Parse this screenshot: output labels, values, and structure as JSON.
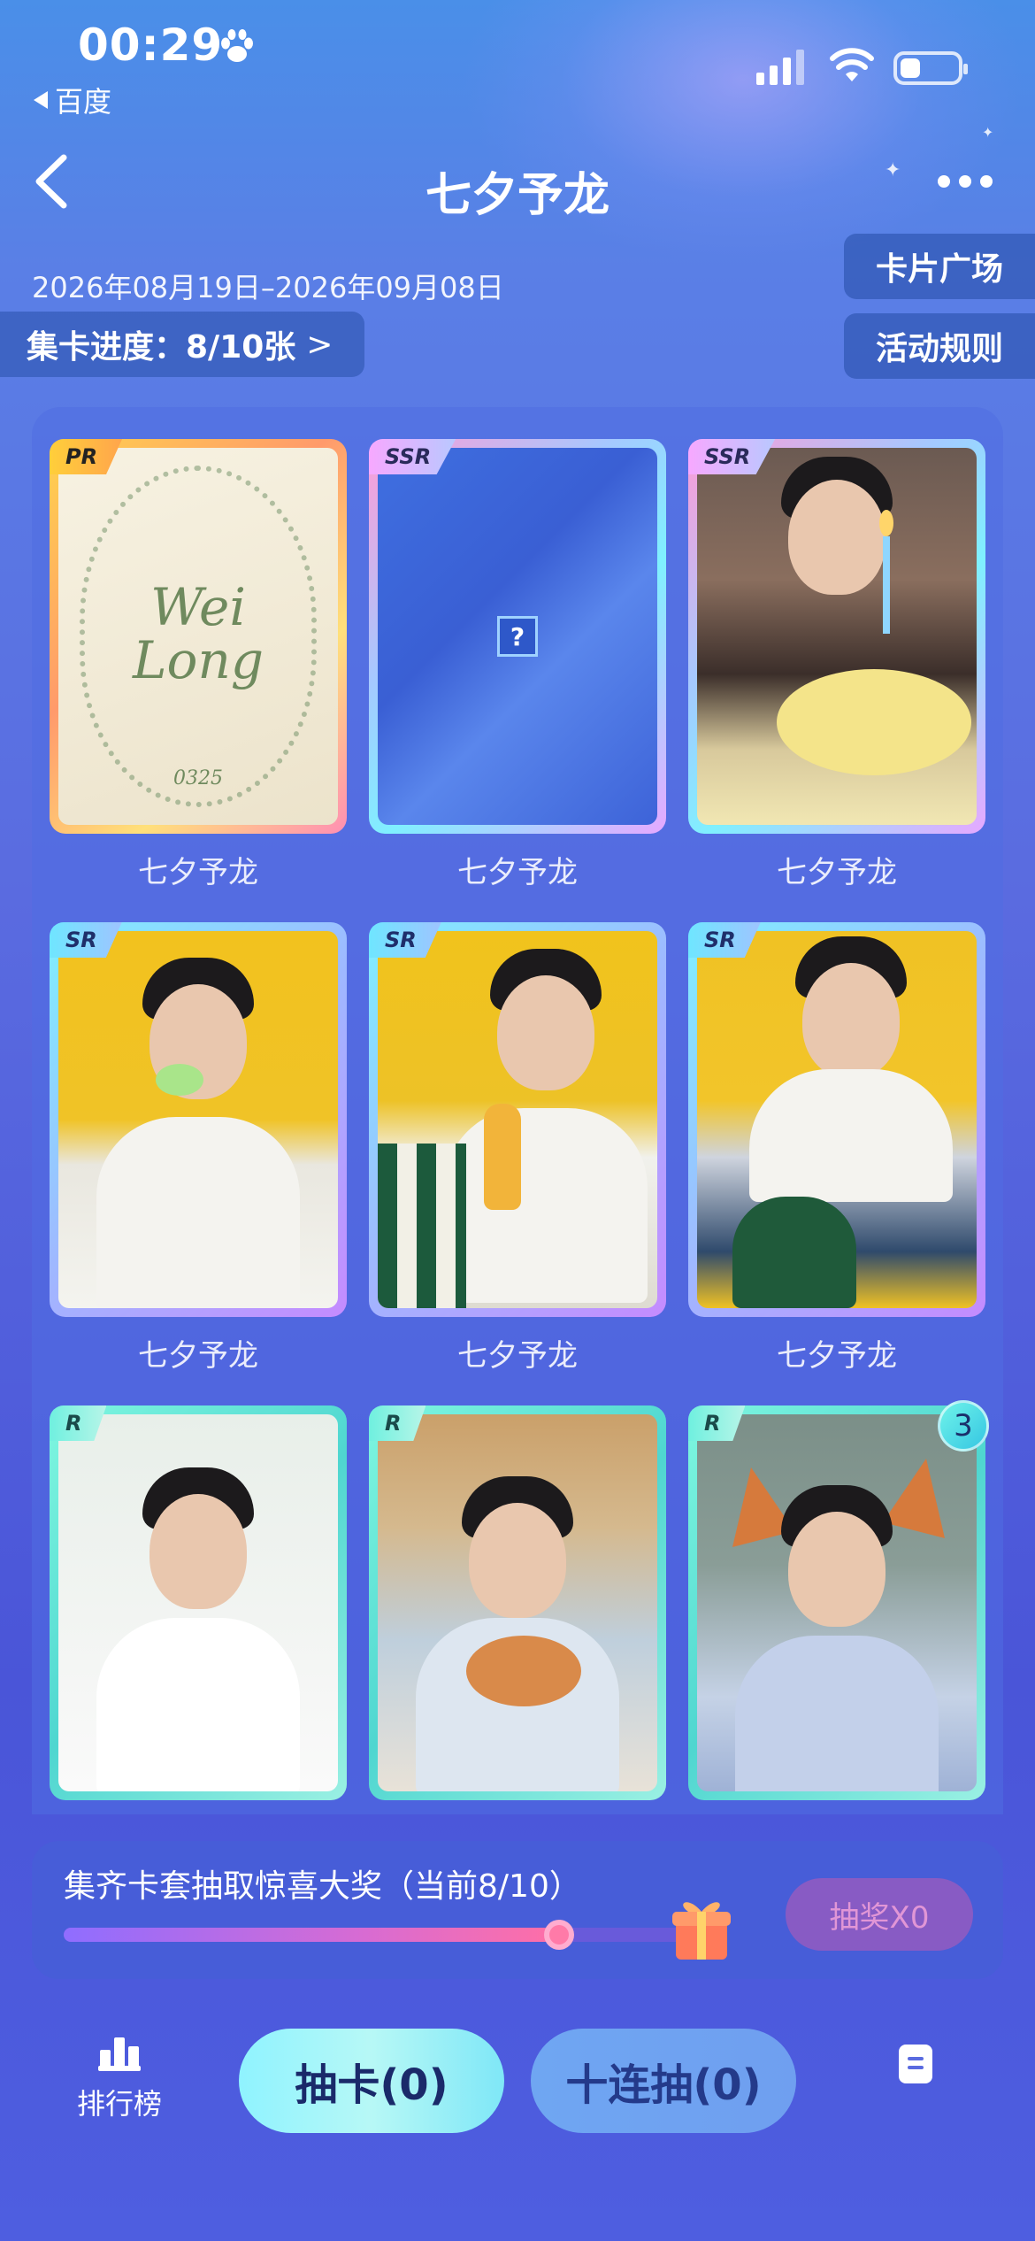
{
  "status_bar": {
    "time": "00:29",
    "back_app": "百度"
  },
  "header": {
    "title": "七夕予龙"
  },
  "info": {
    "date_range": "2026年08月19日–2026年09月08日",
    "progress_label": "集卡进度：8/10张",
    "progress_chevron": ">",
    "card_plaza": "卡片广场",
    "rules": "活动规则"
  },
  "cards": [
    {
      "rarity": "PR",
      "label": "七夕予龙",
      "art": "wreath-wei-long",
      "art_text": "Wei\nLong",
      "art_number": "0325",
      "collected": true
    },
    {
      "rarity": "SSR",
      "label": "七夕予龙",
      "art": "locked",
      "locked_symbol": "?",
      "collected": false
    },
    {
      "rarity": "SSR",
      "label": "七夕予龙",
      "art": "birthday-cake",
      "collected": true
    },
    {
      "rarity": "SR",
      "label": "七夕予龙",
      "art": "yellow-popsicle",
      "collected": true
    },
    {
      "rarity": "SR",
      "label": "七夕予龙",
      "art": "yellow-bottle",
      "collected": true
    },
    {
      "rarity": "SR",
      "label": "七夕予龙",
      "art": "yellow-motorcycle",
      "collected": true
    },
    {
      "rarity": "R",
      "label": "",
      "art": "white-shirt",
      "collected": true
    },
    {
      "rarity": "R",
      "label": "",
      "art": "cat-room",
      "collected": true
    },
    {
      "rarity": "R",
      "label": "",
      "art": "fox-ears",
      "count": "3",
      "collected": true
    }
  ],
  "prize": {
    "title": "集齐卡套抽取惊喜大奖（当前8/10）",
    "progress": 0.8,
    "button": "抽奖X0"
  },
  "actions": {
    "rank": "排行榜",
    "draw": "抽卡(0)",
    "ten_draw": "十连抽(0)"
  },
  "colors": {
    "accent_cyan": "#8ff3ff",
    "background_top": "#4a8fe8",
    "background_bottom": "#4e5ee0"
  },
  "icons": [
    "paw-icon",
    "signal-icon",
    "wifi-icon",
    "battery-icon",
    "back-icon",
    "more-icon",
    "chevron-right-icon",
    "gift-icon",
    "rank-icon",
    "record-icon"
  ]
}
